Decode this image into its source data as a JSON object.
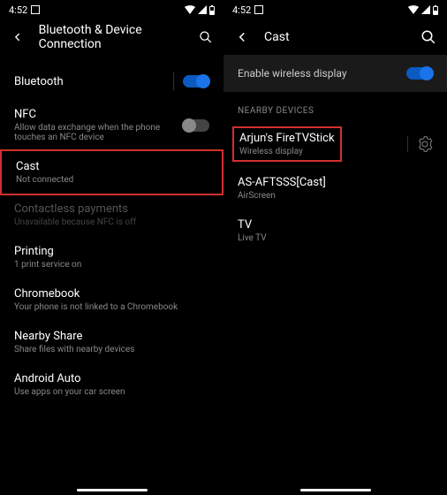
{
  "statusBar": {
    "time": "4:52"
  },
  "leftScreen": {
    "headerTitle": "Bluetooth & Device Connection",
    "items": {
      "bluetooth": {
        "title": "Bluetooth"
      },
      "nfc": {
        "title": "NFC",
        "subtitle": "Allow data exchange when the phone touches an NFC device"
      },
      "cast": {
        "title": "Cast",
        "subtitle": "Not connected"
      },
      "contactless": {
        "title": "Contactless payments",
        "subtitle": "Unavailable because NFC is off"
      },
      "printing": {
        "title": "Printing",
        "subtitle": "1 print service on"
      },
      "chromebook": {
        "title": "Chromebook",
        "subtitle": "Your phone is not linked to a Chromebook"
      },
      "nearbyShare": {
        "title": "Nearby Share",
        "subtitle": "Share files with nearby devices"
      },
      "androidAuto": {
        "title": "Android Auto",
        "subtitle": "Use apps on your car screen"
      }
    }
  },
  "rightScreen": {
    "headerTitle": "Cast",
    "enableLabel": "Enable wireless display",
    "sectionHeader": "NEARBY DEVICES",
    "devices": {
      "d0": {
        "title": "Arjun's FireTVStick",
        "subtitle": "Wireless display"
      },
      "d1": {
        "title": "AS-AFTSSS[Cast]",
        "subtitle": "AirScreen"
      },
      "d2": {
        "title": "TV",
        "subtitle": "Live TV"
      }
    }
  }
}
